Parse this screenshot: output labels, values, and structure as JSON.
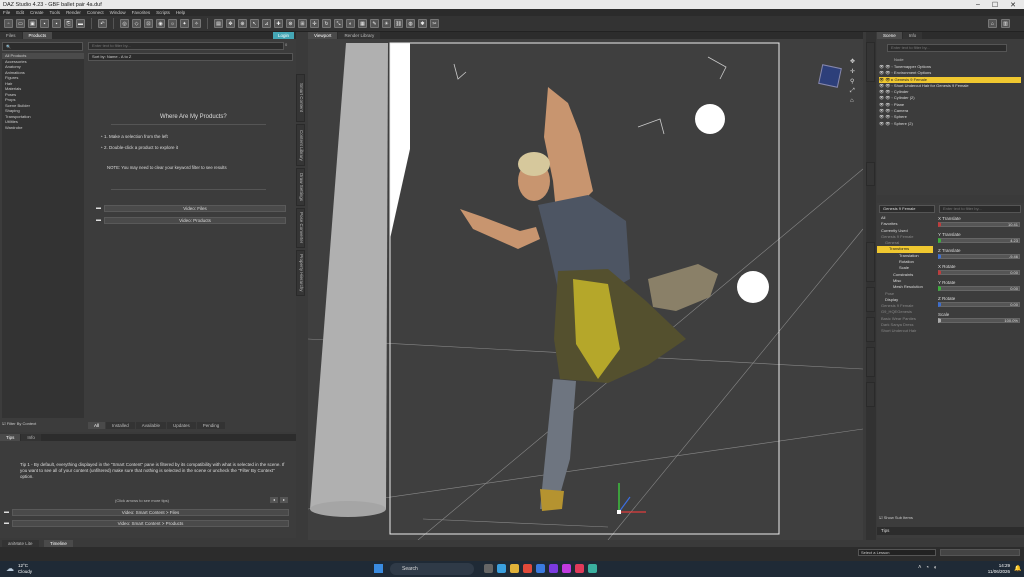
{
  "window": {
    "title": "DAZ Studio 4.23 - GBF ballet pair 4a.duf",
    "controls": [
      "–",
      "☐",
      "✕"
    ]
  },
  "menu": [
    "File",
    "Edit",
    "Create",
    "Tools",
    "Render",
    "Connect",
    "Window",
    "Favorites",
    "Scripts",
    "Help"
  ],
  "left": {
    "tabs": [
      "Files",
      "Products"
    ],
    "login": "Login",
    "categories": [
      "All Products",
      "Accessories",
      "Anatomy",
      "Animations",
      "Figures",
      "Hair",
      "Materials",
      "Poses",
      "Props",
      "Scene Builder",
      "Shaping",
      "Transportation",
      "Utilities",
      "Wardrobe"
    ],
    "search_placeholder": "Enter text to filter by...",
    "sort": "Sort by: Name - A to Z",
    "filter_by_context": "Filter By Context",
    "info_title": "Where Are My Products?",
    "step1": "1. Make a selection from the left",
    "step2": "2. Double-click a product to explore it",
    "note": "NOTE: You may need to clear your keyword filter to see results",
    "video_files": "Video: Files",
    "video_products": "Video: Products",
    "bottom_tabs": [
      "All",
      "Installed",
      "Available",
      "Updates",
      "Pending"
    ],
    "side_tabs": [
      "Smart Content",
      "Content Library",
      "Draw Settings",
      "Pose Converter",
      "Property Hierarchy",
      "Render Settings"
    ],
    "tips_tabs": [
      "Tips",
      "Info"
    ],
    "tip_text": "Tip 1 - By default, everything displayed in the \"Smart Content\" pane is filtered by its compatibility with what is selected in the scene. If you want to see all of your content (unfiltered) make sure that nothing is selected in the scene or uncheck the \"Filter By Context\" option.",
    "click_more": "(Click arrows to see more tips)",
    "video_sc_files": "Video: Smart Content > Files",
    "video_sc_products": "Video: Smart Content > Products"
  },
  "viewport": {
    "tabs": [
      "Viewport",
      "Render Library"
    ],
    "camera": "Camera"
  },
  "scene": {
    "tabs": [
      "Scene",
      "Info"
    ],
    "search_placeholder": "Enter text to filter by...",
    "header": "Node",
    "items": [
      {
        "label": "Tonemapper Options",
        "indent": 1
      },
      {
        "label": "Environment Options",
        "indent": 1
      },
      {
        "label": "Genesis 9 Female",
        "indent": 1,
        "selected": true
      },
      {
        "label": "Short Undercut Hair for Genesis 9 Female",
        "indent": 1
      },
      {
        "label": "Cylinder",
        "indent": 1
      },
      {
        "label": "Cylinder (2)",
        "indent": 1
      },
      {
        "label": "Plane",
        "indent": 1
      },
      {
        "label": "Camera",
        "indent": 1
      },
      {
        "label": "Sphere",
        "indent": 1
      },
      {
        "label": "Sphere (2)",
        "indent": 1
      }
    ]
  },
  "params": {
    "figure": "Genesis 9 Female",
    "search_placeholder": "Enter text to filter by...",
    "tree": [
      "All",
      "Favorites",
      "Currently Used",
      "Genesis 9 Female",
      "General",
      "Transforms",
      "Translation",
      "Rotation",
      "Scale",
      "Constraints",
      "Misc",
      "Mesh Resolution",
      "Pose",
      "Display",
      "Genesis 9 Female",
      "G9_HQEGenesis",
      "Basic Wear Panties",
      "Dark Sanya Dress",
      "Short Undercut Hair"
    ],
    "rows": [
      {
        "label": "X Translate",
        "value": "10.41"
      },
      {
        "label": "Y Translate",
        "value": "4.23"
      },
      {
        "label": "Z Translate",
        "value": "-9.46"
      },
      {
        "label": "X Rotate",
        "value": "0.00"
      },
      {
        "label": "Y Rotate",
        "value": "0.00"
      },
      {
        "label": "Z Rotate",
        "value": "0.00"
      },
      {
        "label": "Scale",
        "value": "100.0%"
      }
    ],
    "show_sub": "Show Sub Items",
    "tips": "Tips"
  },
  "status": {
    "tabs": [
      "aniMate Lite",
      "Timeline"
    ],
    "lesson": "Select a Lesson"
  },
  "taskbar": {
    "temp": "12°C",
    "weather": "Cloudy",
    "search": "Search",
    "time": "14:29",
    "date": "11/06/2026"
  }
}
